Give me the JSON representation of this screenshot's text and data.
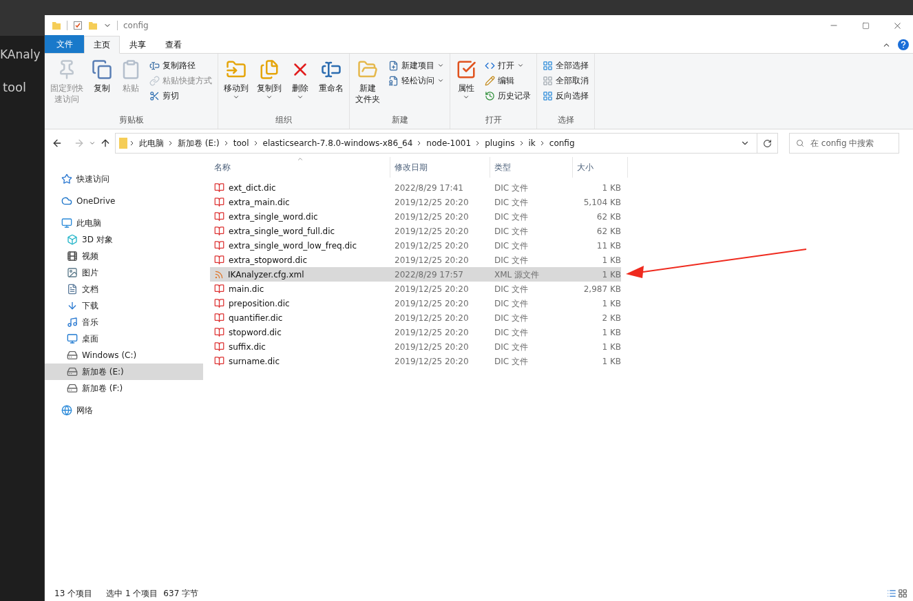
{
  "editor": {
    "tab_title": "KAnaly",
    "breadcrumb": "tool"
  },
  "window": {
    "title": "config"
  },
  "ribbon_tabs": [
    {
      "label": "文件",
      "kind": "file",
      "selected": false
    },
    {
      "label": "主页",
      "kind": "tab",
      "selected": true
    },
    {
      "label": "共享",
      "kind": "tab",
      "selected": false
    },
    {
      "label": "查看",
      "kind": "tab",
      "selected": false
    }
  ],
  "ribbon_groups": [
    {
      "name": "剪贴板",
      "items": [
        {
          "kind": "large",
          "label_lines": [
            "固定到快",
            "速访问"
          ],
          "disabled": true,
          "dropdown": false
        },
        {
          "kind": "large",
          "label_lines": [
            "复制"
          ],
          "disabled": false,
          "dropdown": false
        },
        {
          "kind": "large",
          "label_lines": [
            "粘贴"
          ],
          "disabled": true,
          "dropdown": false
        },
        {
          "kind": "stack",
          "items": [
            {
              "label": "复制路径",
              "disabled": false,
              "dropdown": false
            },
            {
              "label": "粘贴快捷方式",
              "disabled": true,
              "dropdown": false
            },
            {
              "label": "剪切",
              "disabled": false,
              "dropdown": false
            }
          ]
        }
      ]
    },
    {
      "name": "组织",
      "items": [
        {
          "kind": "large",
          "label_lines": [
            "移动到"
          ],
          "disabled": false,
          "dropdown": true
        },
        {
          "kind": "large",
          "label_lines": [
            "复制到"
          ],
          "disabled": false,
          "dropdown": true
        },
        {
          "kind": "large",
          "label_lines": [
            "删除"
          ],
          "disabled": false,
          "dropdown": true
        },
        {
          "kind": "large",
          "label_lines": [
            "重命名"
          ],
          "disabled": false,
          "dropdown": false
        }
      ]
    },
    {
      "name": "新建",
      "items": [
        {
          "kind": "large",
          "label_lines": [
            "新建",
            "文件夹"
          ],
          "disabled": false,
          "dropdown": false
        },
        {
          "kind": "stack",
          "items": [
            {
              "label": "新建项目",
              "disabled": false,
              "dropdown": true
            },
            {
              "label": "轻松访问",
              "disabled": false,
              "dropdown": true
            }
          ]
        }
      ]
    },
    {
      "name": "打开",
      "items": [
        {
          "kind": "large",
          "label_lines": [
            "属性"
          ],
          "disabled": false,
          "dropdown": true
        },
        {
          "kind": "stack",
          "items": [
            {
              "label": "打开",
              "disabled": false,
              "dropdown": true
            },
            {
              "label": "编辑",
              "disabled": false,
              "dropdown": false
            },
            {
              "label": "历史记录",
              "disabled": false,
              "dropdown": false
            }
          ]
        }
      ]
    },
    {
      "name": "选择",
      "items": [
        {
          "kind": "stack",
          "items": [
            {
              "label": "全部选择",
              "disabled": false,
              "dropdown": false
            },
            {
              "label": "全部取消",
              "disabled": false,
              "dropdown": false
            },
            {
              "label": "反向选择",
              "disabled": false,
              "dropdown": false
            }
          ]
        }
      ]
    }
  ],
  "address": {
    "path": [
      "此电脑",
      "新加卷 (E:)",
      "tool",
      "elasticsearch-7.8.0-windows-x86_64",
      "node-1001",
      "plugins",
      "ik",
      "config"
    ],
    "search_placeholder": "在 config 中搜索",
    "forward_disabled": true
  },
  "sidebar": [
    {
      "label": "快速访问",
      "selected": false
    },
    {
      "label": "OneDrive",
      "selected": false
    },
    {
      "label": "此电脑",
      "selected": false,
      "children": [
        {
          "label": "3D 对象",
          "selected": false
        },
        {
          "label": "视频",
          "selected": false
        },
        {
          "label": "图片",
          "selected": false
        },
        {
          "label": "文档",
          "selected": false
        },
        {
          "label": "下载",
          "selected": false
        },
        {
          "label": "音乐",
          "selected": false
        },
        {
          "label": "桌面",
          "selected": false
        },
        {
          "label": "Windows (C:)",
          "selected": false
        },
        {
          "label": "新加卷 (E:)",
          "selected": true
        },
        {
          "label": "新加卷 (F:)",
          "selected": false
        }
      ]
    },
    {
      "label": "网络",
      "selected": false
    }
  ],
  "table": {
    "columns": [
      "名称",
      "修改日期",
      "类型",
      "大小"
    ],
    "rows": [
      {
        "name": "ext_dict.dic",
        "date": "2022/8/29 17:41",
        "type": "DIC 文件",
        "size": "1 KB",
        "kind": "dic",
        "selected": false
      },
      {
        "name": "extra_main.dic",
        "date": "2019/12/25 20:20",
        "type": "DIC 文件",
        "size": "5,104 KB",
        "kind": "dic",
        "selected": false
      },
      {
        "name": "extra_single_word.dic",
        "date": "2019/12/25 20:20",
        "type": "DIC 文件",
        "size": "62 KB",
        "kind": "dic",
        "selected": false
      },
      {
        "name": "extra_single_word_full.dic",
        "date": "2019/12/25 20:20",
        "type": "DIC 文件",
        "size": "62 KB",
        "kind": "dic",
        "selected": false
      },
      {
        "name": "extra_single_word_low_freq.dic",
        "date": "2019/12/25 20:20",
        "type": "DIC 文件",
        "size": "11 KB",
        "kind": "dic",
        "selected": false
      },
      {
        "name": "extra_stopword.dic",
        "date": "2019/12/25 20:20",
        "type": "DIC 文件",
        "size": "1 KB",
        "kind": "dic",
        "selected": false
      },
      {
        "name": "IKAnalyzer.cfg.xml",
        "date": "2022/8/29 17:57",
        "type": "XML 源文件",
        "size": "1 KB",
        "kind": "xml",
        "selected": true
      },
      {
        "name": "main.dic",
        "date": "2019/12/25 20:20",
        "type": "DIC 文件",
        "size": "2,987 KB",
        "kind": "dic",
        "selected": false
      },
      {
        "name": "preposition.dic",
        "date": "2019/12/25 20:20",
        "type": "DIC 文件",
        "size": "1 KB",
        "kind": "dic",
        "selected": false
      },
      {
        "name": "quantifier.dic",
        "date": "2019/12/25 20:20",
        "type": "DIC 文件",
        "size": "2 KB",
        "kind": "dic",
        "selected": false
      },
      {
        "name": "stopword.dic",
        "date": "2019/12/25 20:20",
        "type": "DIC 文件",
        "size": "1 KB",
        "kind": "dic",
        "selected": false
      },
      {
        "name": "suffix.dic",
        "date": "2019/12/25 20:20",
        "type": "DIC 文件",
        "size": "1 KB",
        "kind": "dic",
        "selected": false
      },
      {
        "name": "surname.dic",
        "date": "2019/12/25 20:20",
        "type": "DIC 文件",
        "size": "1 KB",
        "kind": "dic",
        "selected": false
      }
    ]
  },
  "status_bar": {
    "count": "13 个项目",
    "selection": "选中 1 个项目",
    "size": "637 字节"
  }
}
